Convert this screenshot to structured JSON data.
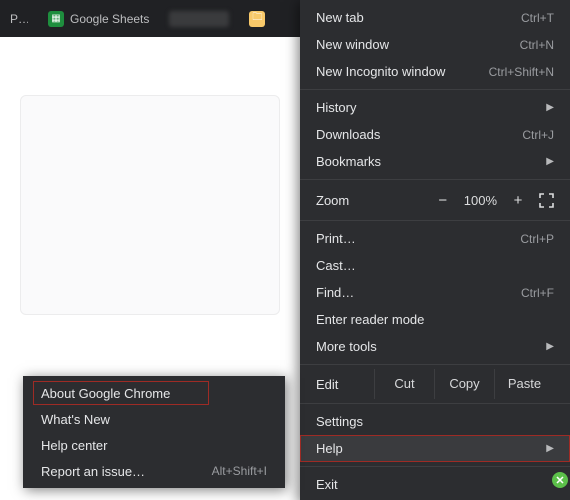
{
  "tabs": [
    {
      "label": "Ph…",
      "favicon": "photos"
    },
    {
      "label": "Google Sheets",
      "favicon": "sheets"
    },
    {
      "label": "",
      "favicon": "blur"
    },
    {
      "label": "",
      "favicon": "folder"
    }
  ],
  "menu": {
    "new_tab": {
      "label": "New tab",
      "shortcut": "Ctrl+T"
    },
    "new_window": {
      "label": "New window",
      "shortcut": "Ctrl+N"
    },
    "new_incognito": {
      "label": "New Incognito window",
      "shortcut": "Ctrl+Shift+N"
    },
    "history": {
      "label": "History"
    },
    "downloads": {
      "label": "Downloads",
      "shortcut": "Ctrl+J"
    },
    "bookmarks": {
      "label": "Bookmarks"
    },
    "zoom": {
      "label": "Zoom",
      "value": "100%",
      "minus": "−",
      "plus": "+"
    },
    "print": {
      "label": "Print…",
      "shortcut": "Ctrl+P"
    },
    "cast": {
      "label": "Cast…"
    },
    "find": {
      "label": "Find…",
      "shortcut": "Ctrl+F"
    },
    "reader": {
      "label": "Enter reader mode"
    },
    "more_tools": {
      "label": "More tools"
    },
    "edit": {
      "label": "Edit",
      "cut": "Cut",
      "copy": "Copy",
      "paste": "Paste"
    },
    "settings": {
      "label": "Settings"
    },
    "help": {
      "label": "Help"
    },
    "exit": {
      "label": "Exit"
    }
  },
  "submenu": {
    "about": {
      "label": "About Google Chrome"
    },
    "whats_new": {
      "label": "What's New"
    },
    "help_center": {
      "label": "Help center"
    },
    "report": {
      "label": "Report an issue…",
      "shortcut": "Alt+Shift+I"
    }
  },
  "highlight_color": "#9e2b25"
}
